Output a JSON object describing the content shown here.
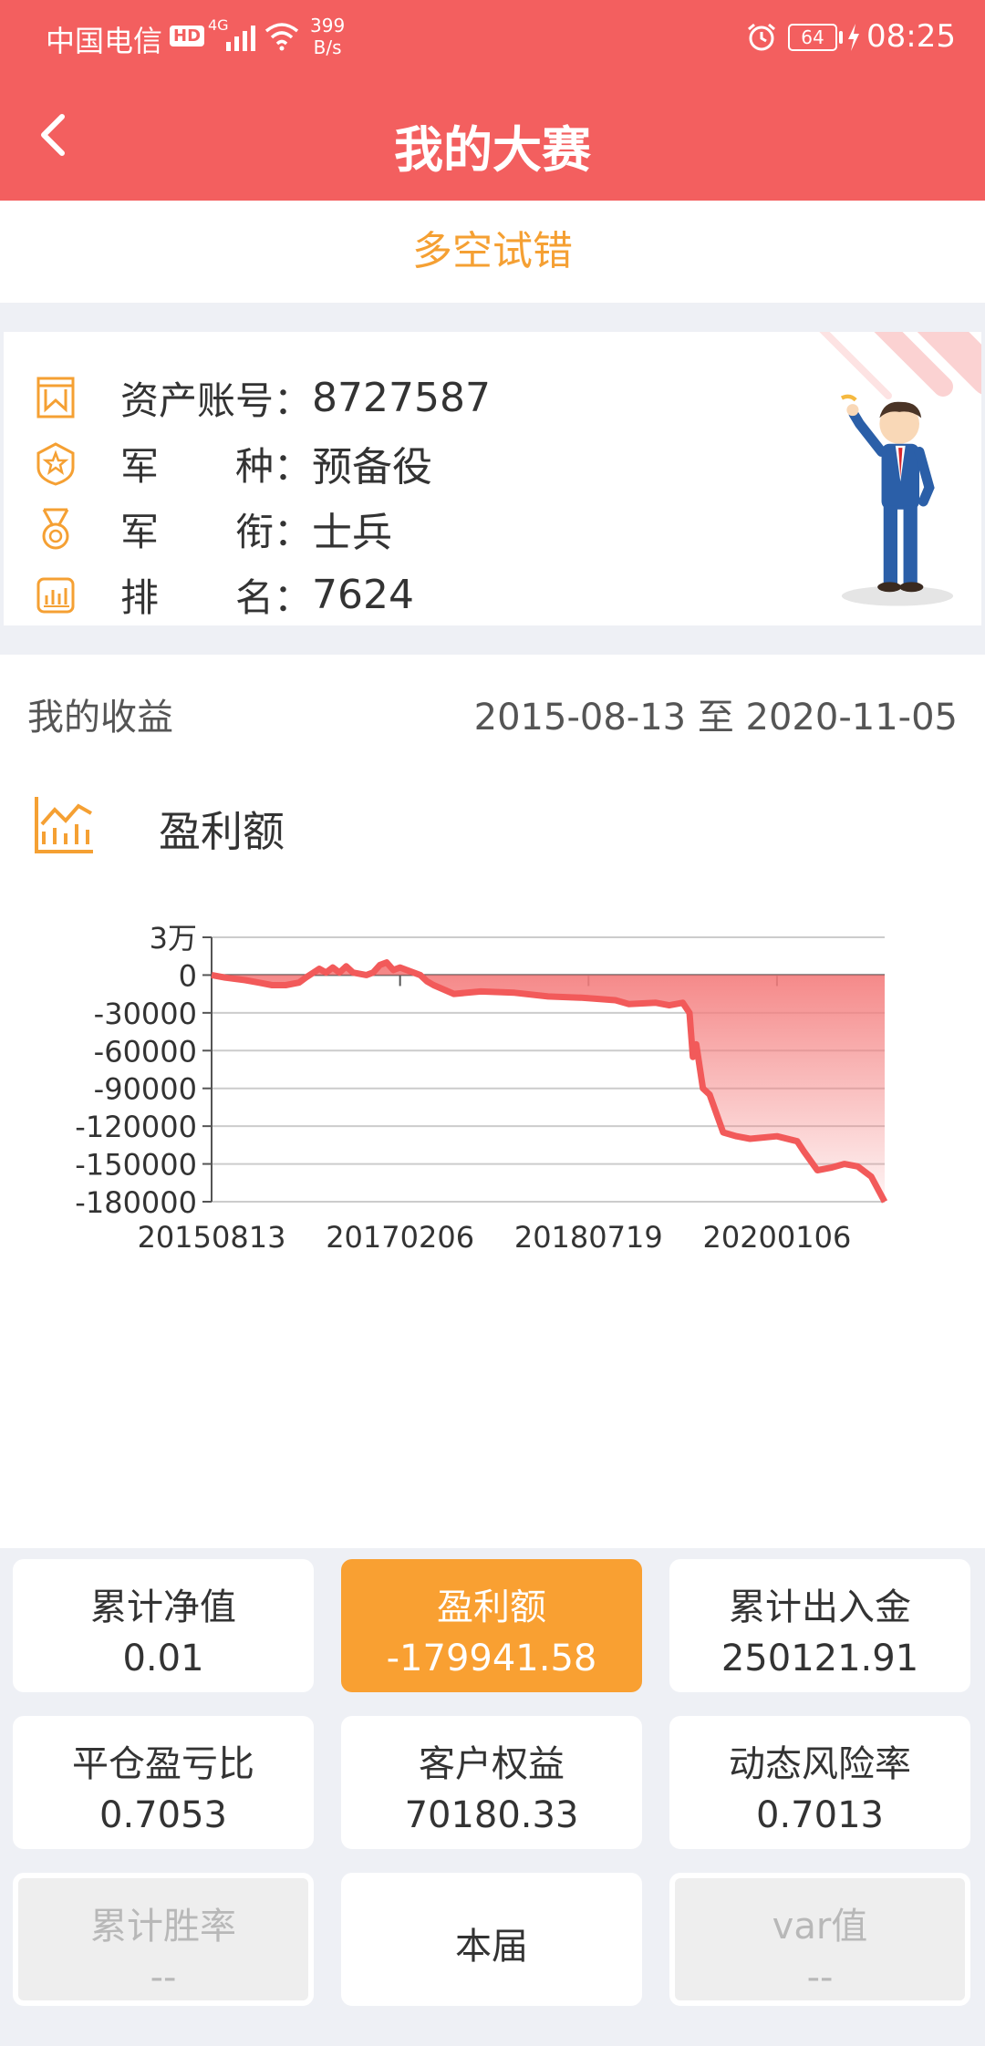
{
  "status_bar": {
    "carrier": "中国电信",
    "hd_badge": "HD",
    "network": "4G",
    "speed_value": "399",
    "speed_unit": "B/s",
    "battery": "64",
    "time": "08:25"
  },
  "app_bar": {
    "title": "我的大赛"
  },
  "subtitle": "多空试错",
  "account_info": [
    {
      "label": "资产账号：",
      "value": "8727587",
      "icon": "bookmark-icon"
    },
    {
      "label": "军　　种：",
      "value": "预备役",
      "icon": "star-shield-icon"
    },
    {
      "label": "军　　衔：",
      "value": "士兵",
      "icon": "medal-icon"
    },
    {
      "label": "排　　名：",
      "value": "7624",
      "icon": "bar-chart-icon"
    }
  ],
  "earnings": {
    "label": "我的收益",
    "date_range": "2015-08-13 至 2020-11-05",
    "chart_title": "盈利额",
    "chart_icon": "trend-chart-icon"
  },
  "chart_data": {
    "type": "area",
    "title": "",
    "xlabel": "",
    "ylabel": "",
    "ylim": [
      -180000,
      30000
    ],
    "y_ticks": [
      "3万",
      "0",
      "-30000",
      "-60000",
      "-90000",
      "-120000",
      "-150000",
      "-180000"
    ],
    "x_ticks": [
      "20150813",
      "20170206",
      "20180719",
      "20200106"
    ],
    "line_color": "#f25a5a",
    "fill_color": "#f47d7d",
    "grid": true,
    "series": [
      {
        "x": [
          0,
          0.02,
          0.05,
          0.07,
          0.09,
          0.11,
          0.13,
          0.14,
          0.16,
          0.17,
          0.18,
          0.19,
          0.2,
          0.21,
          0.23,
          0.24,
          0.25,
          0.26,
          0.27,
          0.28,
          0.3,
          0.31,
          0.32,
          0.33,
          0.36,
          0.4,
          0.45,
          0.5,
          0.55,
          0.6,
          0.62,
          0.66,
          0.68,
          0.7,
          0.71,
          0.715,
          0.72,
          0.73,
          0.74,
          0.75,
          0.76,
          0.78,
          0.8,
          0.84,
          0.87,
          0.88,
          0.9,
          0.92,
          0.94,
          0.96,
          0.98,
          1.0
        ],
        "values": [
          0,
          -2000,
          -4000,
          -6000,
          -8000,
          -8000,
          -6000,
          -2000,
          5000,
          2000,
          6000,
          2000,
          7000,
          2000,
          0,
          2000,
          8000,
          10000,
          4000,
          6000,
          2000,
          0,
          -5000,
          -8000,
          -15000,
          -13000,
          -14000,
          -17000,
          -18000,
          -20000,
          -23000,
          -22000,
          -24000,
          -22000,
          -30000,
          -65000,
          -55000,
          -90000,
          -95000,
          -110000,
          -125000,
          -128000,
          -130000,
          -128000,
          -132000,
          -140000,
          -155000,
          -153000,
          -150000,
          -152000,
          -160000,
          -180000
        ]
      }
    ]
  },
  "stats": [
    {
      "title": "累计净值",
      "value": "0.01",
      "state": "normal"
    },
    {
      "title": "盈利额",
      "value": "-179941.58",
      "state": "active"
    },
    {
      "title": "累计出入金",
      "value": "250121.91",
      "state": "normal"
    },
    {
      "title": "平仓盈亏比",
      "value": "0.7053",
      "state": "normal"
    },
    {
      "title": "客户权益",
      "value": "70180.33",
      "state": "normal"
    },
    {
      "title": "动态风险率",
      "value": "0.7013",
      "state": "normal"
    },
    {
      "title": "累计胜率",
      "value": "--",
      "state": "disabled"
    },
    {
      "title": "本届",
      "value": "",
      "state": "single"
    },
    {
      "title": "var值",
      "value": "--",
      "state": "disabled"
    }
  ]
}
